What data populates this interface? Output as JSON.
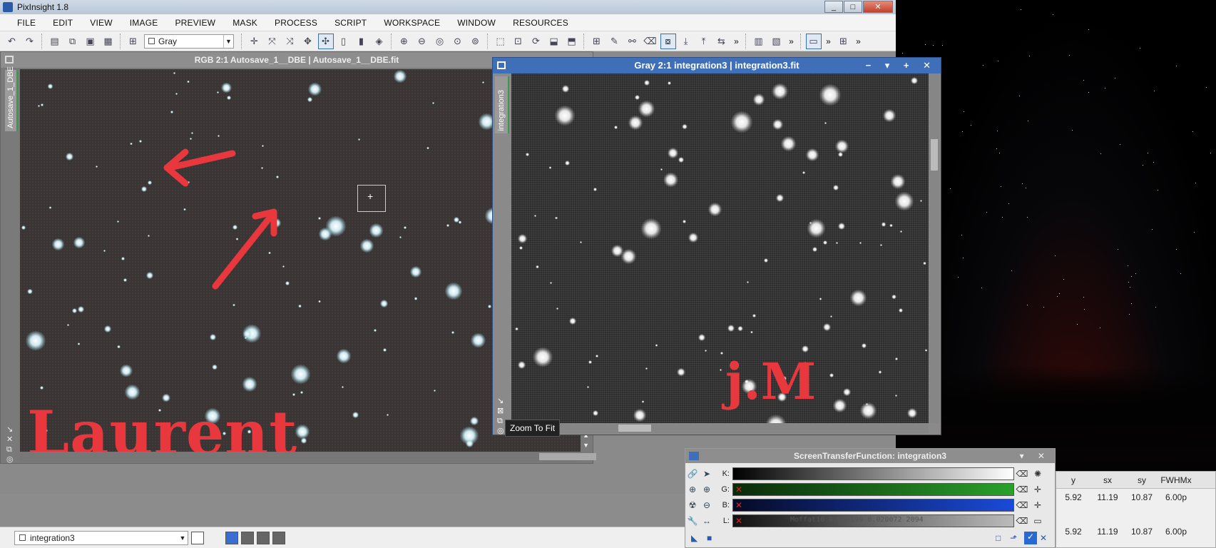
{
  "app": {
    "title": "PixInsight 1.8",
    "win_min": "_",
    "win_max": "□",
    "win_close": "✕"
  },
  "menu": {
    "items": [
      "FILE",
      "EDIT",
      "VIEW",
      "IMAGE",
      "PREVIEW",
      "MASK",
      "PROCESS",
      "SCRIPT",
      "WORKSPACE",
      "WINDOW",
      "RESOURCES"
    ]
  },
  "toolbar": {
    "view_combo_value": "Gray",
    "icons": [
      "undo-icon",
      "redo-icon",
      "new-icon",
      "duplicate-icon",
      "copy-icon",
      "paste-icon",
      "new-preview-icon"
    ]
  },
  "rgb_window": {
    "title": "RGB 2:1 Autosave_1__DBE | Autosave_1__DBE.fit",
    "side_tab": "Autosave_1_DBE",
    "annotation": "Laurent"
  },
  "gray_window": {
    "title": "Gray 2:1 integration3 | integration3.fit",
    "side_tab": "integration3",
    "annotation": "j.M",
    "controls": "− ▾ + ✕"
  },
  "tooltip": {
    "text": "Zoom To Fit"
  },
  "stf": {
    "title": "ScreenTransferFunction: integration3",
    "channels": [
      {
        "label": "K:",
        "color": "#000000"
      },
      {
        "label": "G:",
        "color": "#1e8a1e"
      },
      {
        "label": "B:",
        "color": "#1a3aa8"
      },
      {
        "label": "L:",
        "color": "#888888"
      }
    ],
    "ghost_text": "Moffat10   0.028599 0.020072  2094"
  },
  "data_table": {
    "headers": [
      "y",
      "sx",
      "sy",
      "FWHMx"
    ],
    "rows": [
      [
        "5.92",
        "11.19",
        "10.87",
        "6.00p"
      ],
      [
        "5.92",
        "11.19",
        "10.87",
        "6.00p"
      ]
    ]
  },
  "status": {
    "view_value": "integration3"
  }
}
